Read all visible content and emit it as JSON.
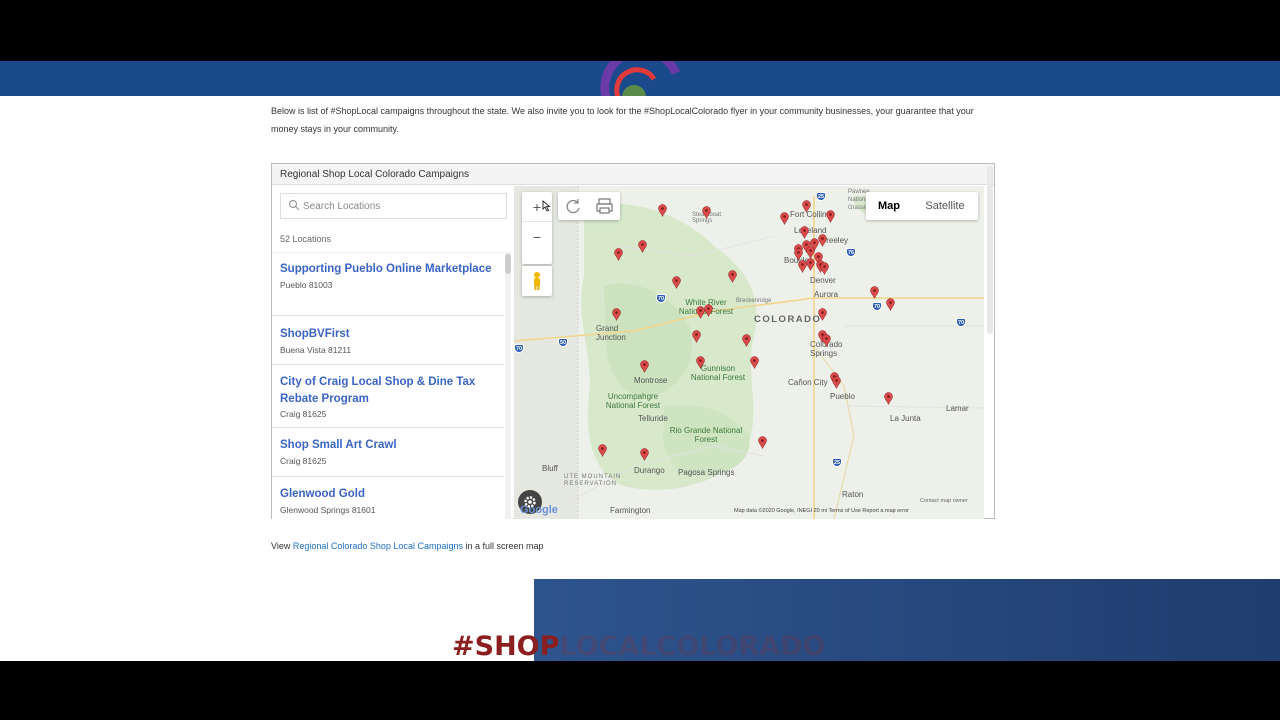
{
  "intro_text": "Below is list of #ShopLocal campaigns throughout the state. We also invite you to look for the #ShopLocalColorado flyer  in your community businesses, your guarantee that your money stays in your community.",
  "widget": {
    "title": "Regional Shop Local Colorado Campaigns",
    "search_placeholder": "Search Locations",
    "location_count": "52 Locations",
    "items": [
      {
        "title": "Supporting Pueblo Online Marketplace",
        "sub": "Pueblo 81003"
      },
      {
        "title": "ShopBVFirst",
        "sub": "Buena Vista 81211"
      },
      {
        "title": "City of Craig Local Shop & Dine Tax Rebate Program",
        "sub": "Craig 81625"
      },
      {
        "title": "Shop Small Art Crawl",
        "sub": "Craig 81625"
      },
      {
        "title": "Glenwood Gold",
        "sub": "Glenwood Springs 81601"
      }
    ]
  },
  "map": {
    "zoom_in": "+",
    "zoom_out": "−",
    "map_button": "Map",
    "satellite_button": "Satellite",
    "state_label": "COLORADO",
    "city_labels": [
      "Fort Collins",
      "Loveland",
      "Greeley",
      "Boulder",
      "Denver",
      "Aurora",
      "Colorado Springs",
      "Grand Junction",
      "Montrose",
      "Pueblo",
      "Cañon City",
      "Durango",
      "Pagosa Springs",
      "Farmington",
      "Lamar",
      "La Junta",
      "Raton",
      "Telluride",
      "Bluff",
      "Breckenridge",
      "Steamboat Springs",
      "Pawnee National Grassland"
    ],
    "forest_labels": [
      "White River National Forest",
      "Gunnison National Forest",
      "Uncompahgre National Forest",
      "Rio Grande National Forest",
      "UTE MOUNTAIN RESERVATION"
    ],
    "attribution": "Map data ©2020 Google, INEGI   20 mi        Terms of Use    Report a map error",
    "contact_owner": "Contact map owner",
    "google": "Google",
    "pin_color": "#d94a4a"
  },
  "below_link": {
    "prefix": "View ",
    "link": "Regional Colorado Shop Local Campaigns",
    "suffix": " in a full screen map"
  },
  "hashtag": {
    "visible": "#SHOP",
    "faded": "LOCALCOLORADO"
  },
  "colors": {
    "header_blue": "#1a4a8c",
    "link_blue": "#3a64c4"
  }
}
